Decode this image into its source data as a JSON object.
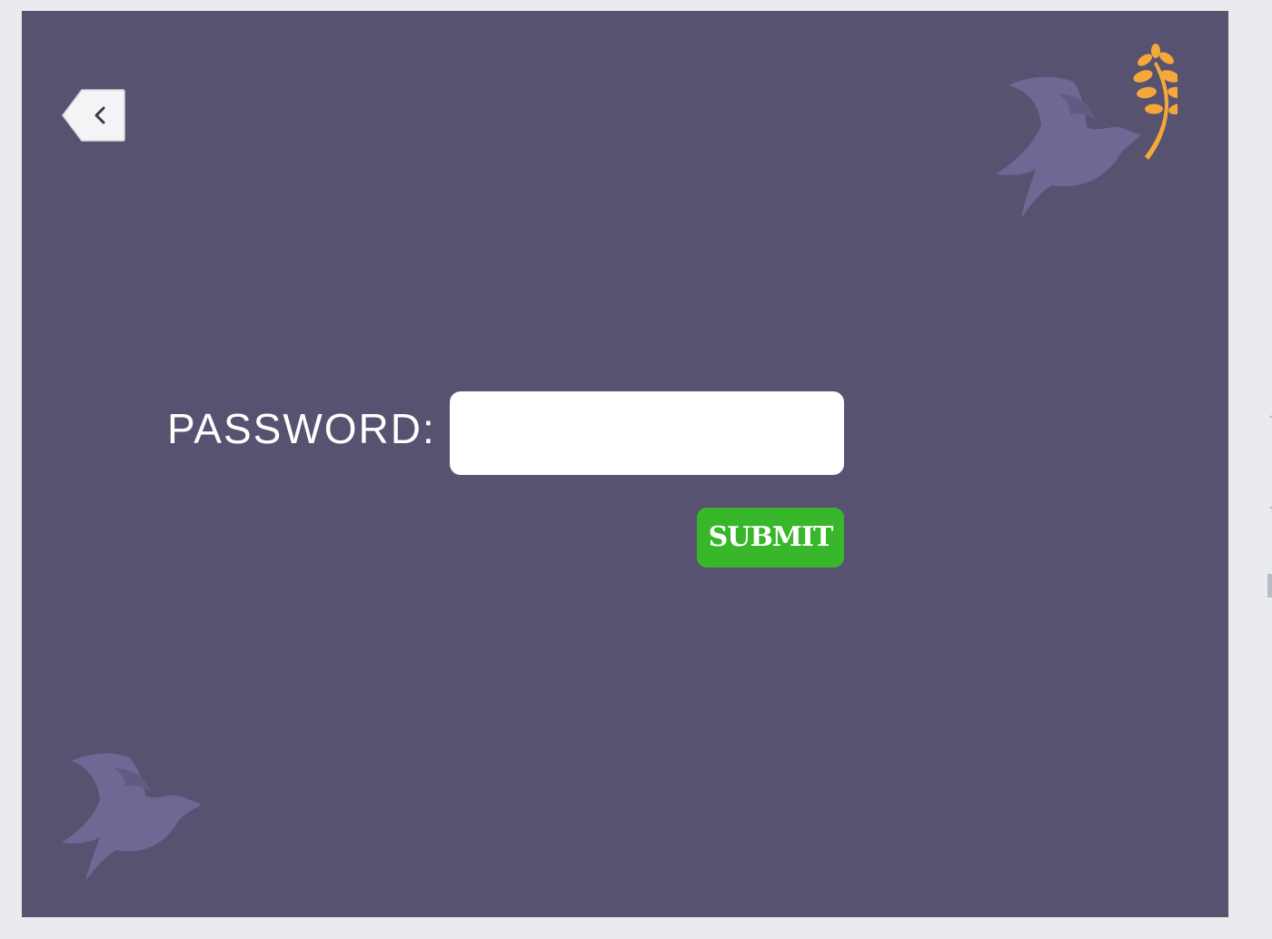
{
  "colors": {
    "page_background": "#e9ebee",
    "stage_background": "#57526f",
    "dove": "#716794",
    "branch": "#f5a83a",
    "submit_background": "#38b72b",
    "input_background": "#ffffff",
    "text": "#ffffff"
  },
  "icons": {
    "back": "chevron-left-icon",
    "dove_with_branch": "dove-with-olive-branch-icon",
    "dove": "dove-icon"
  },
  "login": {
    "password_label": "PASSWORD:",
    "password_value": "",
    "submit_label": "SUBMIT"
  }
}
